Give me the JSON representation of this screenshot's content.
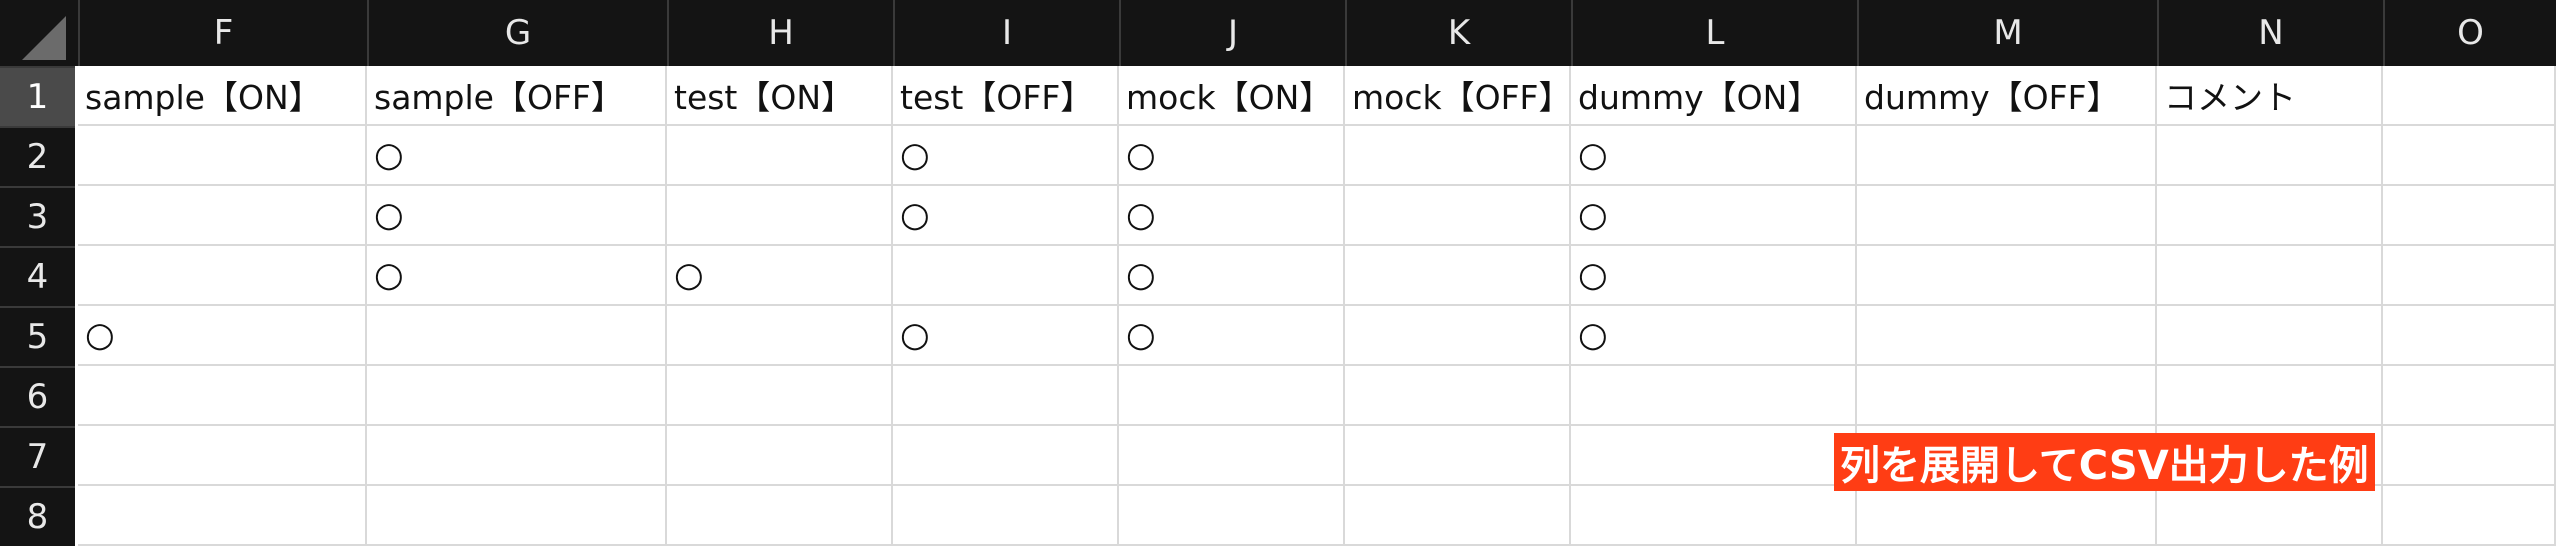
{
  "columns": [
    "F",
    "G",
    "H",
    "I",
    "J",
    "K",
    "L",
    "M",
    "N",
    "O"
  ],
  "rows": [
    "1",
    "2",
    "3",
    "4",
    "5",
    "6",
    "7",
    "8"
  ],
  "selected_row": "1",
  "header_row": [
    "sample【ON】",
    "sample【OFF】",
    "test【ON】",
    "test【OFF】",
    "mock【ON】",
    "mock【OFF】",
    "dummy【ON】",
    "dummy【OFF】",
    "コメント",
    ""
  ],
  "data_rows": [
    [
      "",
      "○",
      "",
      "○",
      "○",
      "",
      "○",
      "",
      "",
      ""
    ],
    [
      "",
      "○",
      "",
      "○",
      "○",
      "",
      "○",
      "",
      "",
      ""
    ],
    [
      "",
      "○",
      "○",
      "",
      "○",
      "",
      "○",
      "",
      "",
      ""
    ],
    [
      "○",
      "",
      "",
      "○",
      "○",
      "",
      "○",
      "",
      "",
      ""
    ],
    [
      "",
      "",
      "",
      "",
      "",
      "",
      "",
      "",
      "",
      ""
    ],
    [
      "",
      "",
      "",
      "",
      "",
      "",
      "",
      "",
      "",
      ""
    ],
    [
      "",
      "",
      "",
      "",
      "",
      "",
      "",
      "",
      "",
      ""
    ]
  ],
  "overlay_caption": "列を展開してCSV出力した例",
  "colors": {
    "header_bg": "#141414",
    "selected_row_header": "#4a4a4a",
    "caption_bg": "#ff3d14"
  }
}
